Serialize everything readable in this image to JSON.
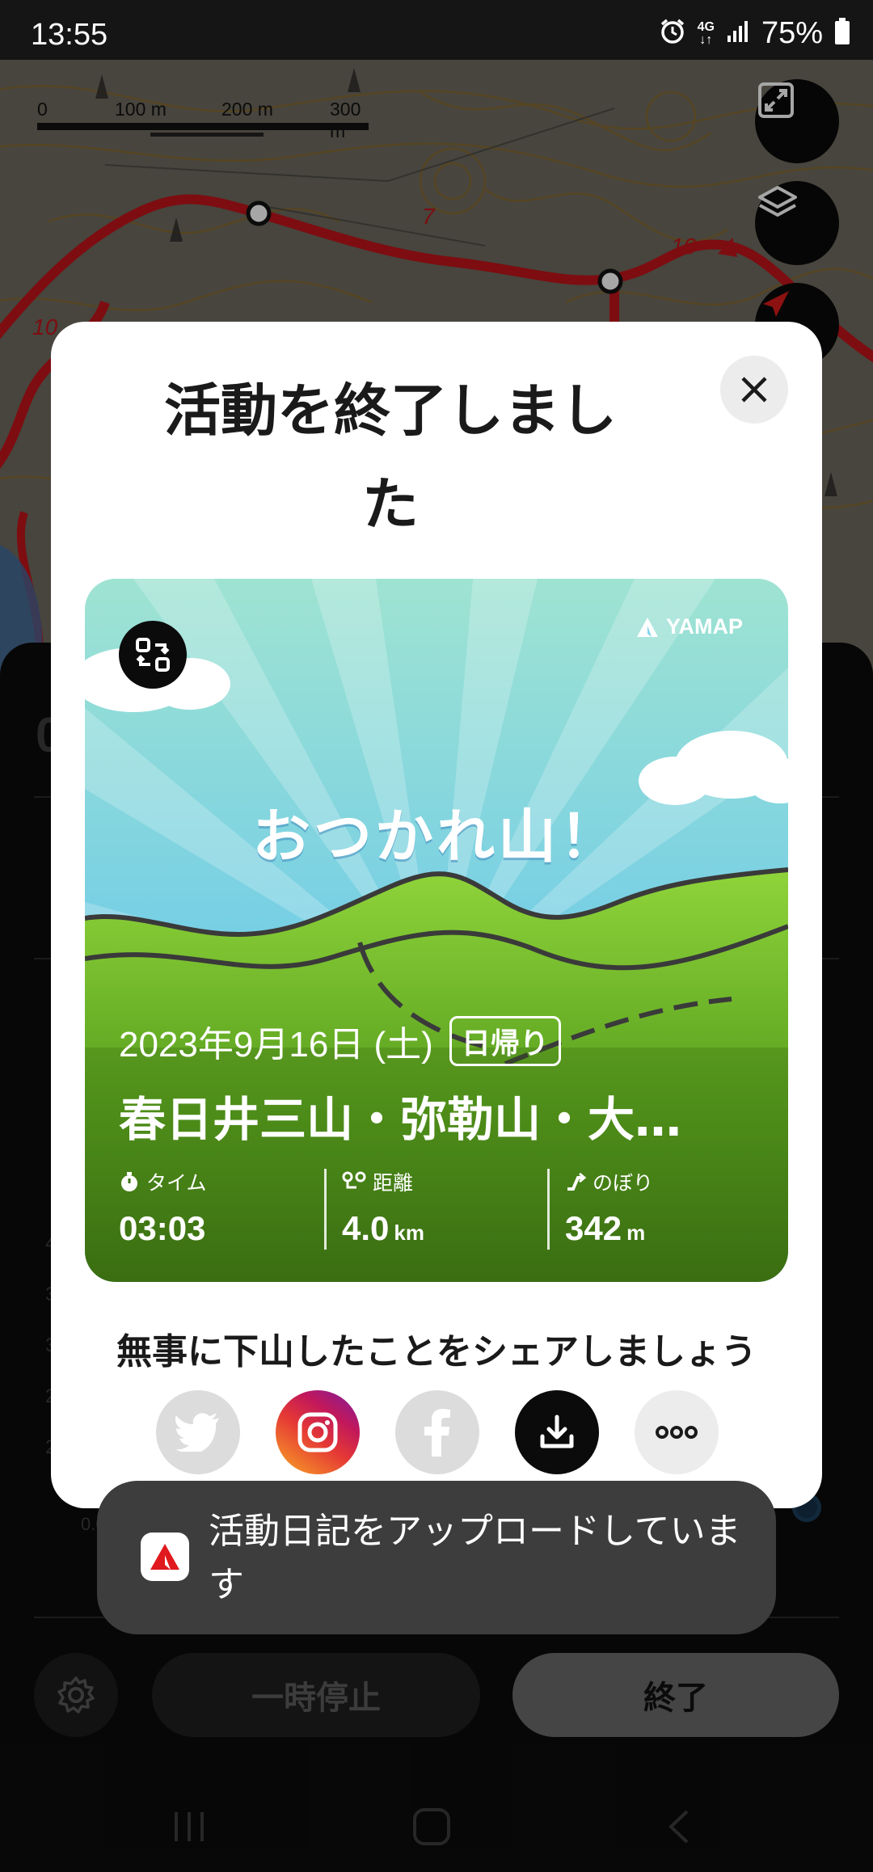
{
  "status_bar": {
    "time": "13:55",
    "network": "4G",
    "battery": "75%",
    "icons": [
      "alarm-icon",
      "data-arrows-icon",
      "signal-icon",
      "battery-icon"
    ]
  },
  "map": {
    "scale_labels": [
      "0",
      "100 m",
      "200 m",
      "300 m"
    ],
    "contour_labels": [
      "7",
      "10",
      "10"
    ],
    "buttons": [
      "fullscreen-icon",
      "layers-icon",
      "compass-icon"
    ]
  },
  "modal": {
    "title": "活動を終了しました",
    "close_icon": "close-icon",
    "card": {
      "brand": "YAMAP",
      "heading": "おつかれ山！",
      "date": "2023年9月16日 (土)",
      "badge": "日帰り",
      "mountain": "春日井三山・弥勒山・大…",
      "stats": [
        {
          "label": "タイム",
          "value": "03:03",
          "unit": "",
          "icon": "stopwatch-icon"
        },
        {
          "label": "距離",
          "value": "4.0",
          "unit": "km",
          "icon": "route-icon"
        },
        {
          "label": "のぼり",
          "value": "342",
          "unit": "m",
          "icon": "climb-icon"
        }
      ]
    },
    "share_prompt": "無事に下山したことをシェアしましょう",
    "share_buttons": [
      "twitter-icon",
      "instagram-icon",
      "facebook-icon",
      "download-icon",
      "more-icon"
    ]
  },
  "toast": {
    "text": "活動日記をアップロードしています",
    "icon": "yamap-app-icon"
  },
  "sheet": {
    "ghost_labels": [
      "4",
      "3",
      "3",
      "2",
      "2",
      "0.0km"
    ]
  },
  "controls": {
    "pause_label": "一時停止",
    "finish_label": "終了",
    "settings_icon": "gear-icon"
  },
  "nav": [
    "recents-icon",
    "home-icon",
    "back-icon"
  ],
  "colors": {
    "route": "#c0141b",
    "card_sky": "#7fd3ea",
    "card_grass": "#5aa11f",
    "instagram_start": "#f9a825",
    "instagram_end": "#c2185b"
  }
}
